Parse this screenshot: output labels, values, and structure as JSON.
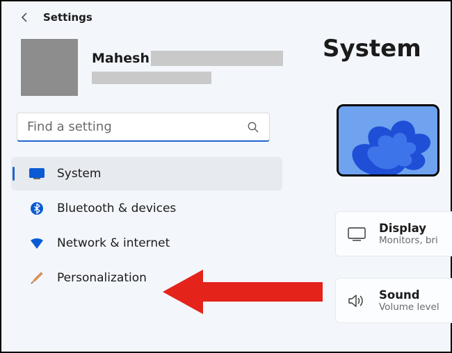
{
  "header": {
    "title": "Settings"
  },
  "user": {
    "name": "Mahesh"
  },
  "search": {
    "placeholder": "Find a setting"
  },
  "nav": {
    "items": [
      {
        "label": "System"
      },
      {
        "label": "Bluetooth & devices"
      },
      {
        "label": "Network & internet"
      },
      {
        "label": "Personalization"
      }
    ]
  },
  "page": {
    "title": "System"
  },
  "cards": {
    "display": {
      "title": "Display",
      "subtitle": "Monitors, bri"
    },
    "sound": {
      "title": "Sound",
      "subtitle": "Volume level"
    }
  },
  "colors": {
    "accent": "#1f63d1"
  }
}
